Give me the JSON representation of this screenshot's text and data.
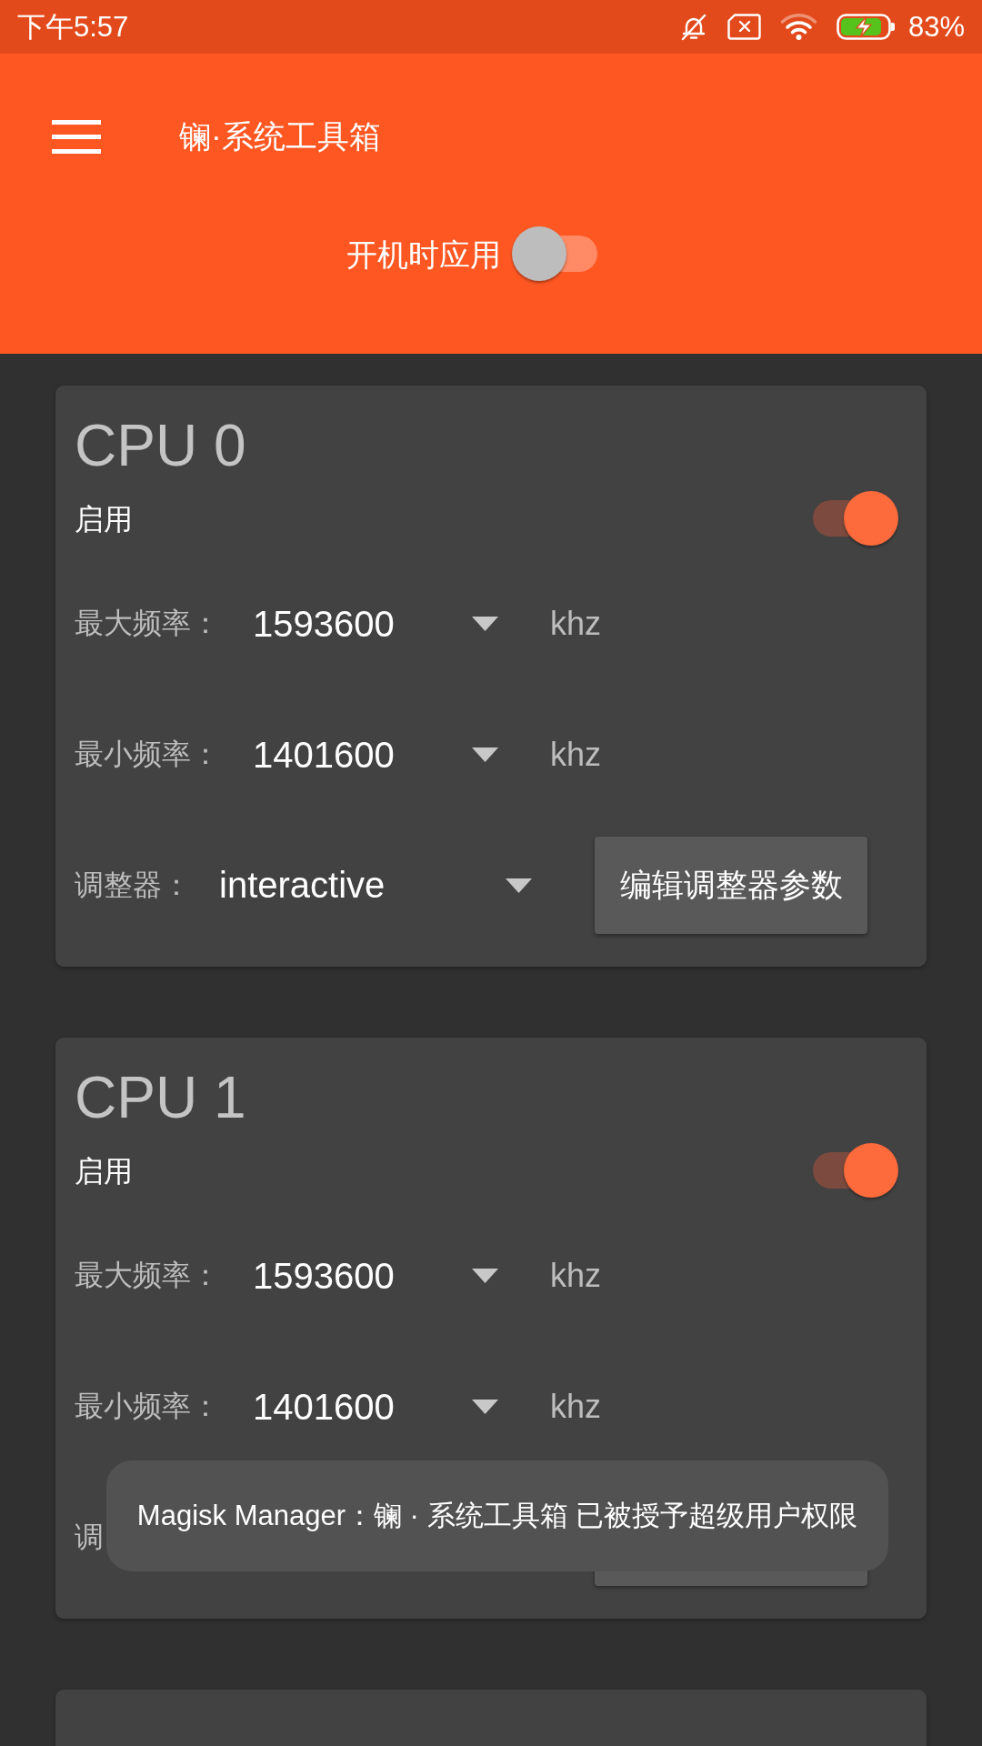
{
  "status_bar": {
    "time": "下午5:57",
    "battery": "83%"
  },
  "app_bar": {
    "title": "镧·系统工具箱",
    "boot_toggle": {
      "label": "开机时应用",
      "on": false
    }
  },
  "cpus": [
    {
      "title": "CPU 0",
      "enable": {
        "label": "启用",
        "on": true
      },
      "rows": [
        {
          "kind": "frequency",
          "label": "最大频率：",
          "value": "1593600",
          "unit": "khz"
        },
        {
          "kind": "frequency",
          "label": "最小频率：",
          "value": "1401600",
          "unit": "khz"
        },
        {
          "kind": "governor",
          "label": "调整器：",
          "value": "interactive",
          "button": "编辑调整器参数"
        }
      ]
    },
    {
      "title": "CPU 1",
      "enable": {
        "label": "启用",
        "on": true
      },
      "rows": [
        {
          "kind": "frequency",
          "label": "最大频率：",
          "value": "1593600",
          "unit": "khz"
        },
        {
          "kind": "frequency",
          "label": "最小频率：",
          "value": "1401600",
          "unit": "khz"
        },
        {
          "kind": "governor",
          "label": "调"
        }
      ]
    }
  ],
  "more_cards_below": true,
  "toast": {
    "text": "Magisk Manager：镧 · 系统工具箱 已被授予超级用户权限"
  }
}
